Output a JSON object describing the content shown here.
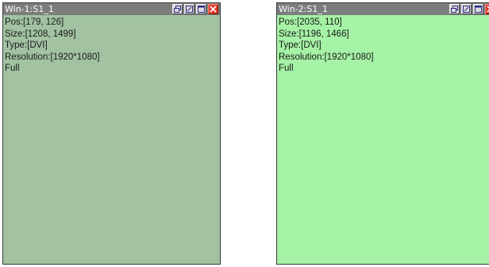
{
  "windows": [
    {
      "title": "Win-1:S1_1",
      "pos": "Pos:[179, 126]",
      "size": "Size:[1208, 1499]",
      "type": "Type:[DVI]",
      "resolution": "Resolution:[1920*1080]",
      "mode": "Full",
      "bg_color": "#a2c2a2"
    },
    {
      "title": "Win-2:S1_1",
      "pos": "Pos:[2035, 110]",
      "size": "Size:[1196, 1466]",
      "type": "Type:[DVI]",
      "resolution": "Resolution:[1920*1080]",
      "mode": "Full",
      "bg_color": "#a6f2a6"
    }
  ],
  "title_buttons": [
    "restore-icon",
    "edit-icon",
    "maximize-icon",
    "close-icon"
  ],
  "colors": {
    "titlebar": "#7d7d7d",
    "close_button": "#e23a2a"
  }
}
